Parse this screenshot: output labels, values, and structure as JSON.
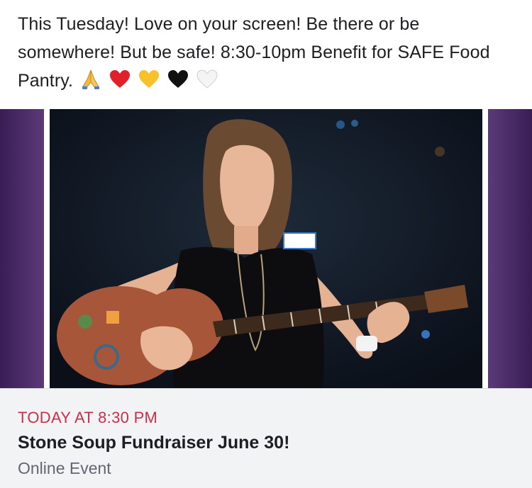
{
  "post": {
    "text": "This Tuesday! Love on your screen! Be there or be somewhere! But be safe! 8:30-10pm Benefit for SAFE Food Pantry.",
    "emojis": [
      "folded-hands-icon",
      "red-heart-icon",
      "yellow-heart-icon",
      "black-heart-icon",
      "white-heart-icon"
    ]
  },
  "event": {
    "time": "TODAY AT 8:30 PM",
    "title": "Stone Soup Fundraiser June 30!",
    "subtitle": "Online Event"
  },
  "colors": {
    "event_time": "#c7304a",
    "info_bg": "#f2f3f5",
    "frame_purple": "#4a2a66"
  }
}
